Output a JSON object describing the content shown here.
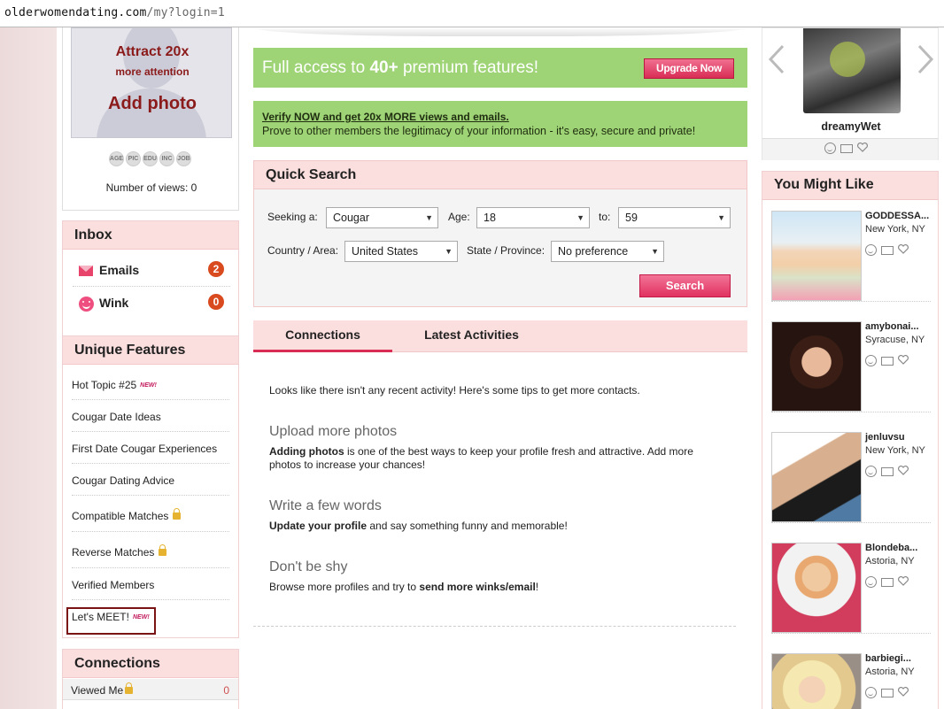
{
  "browser": {
    "url_main": "olderwomendating.com",
    "url_path": "/my?login=1"
  },
  "profile_box": {
    "attract": "Attract 20x",
    "more_attention": "more attention",
    "add_photo": "Add photo",
    "badges": [
      "AGE",
      "PIC",
      "EDU",
      "INC",
      "JOB"
    ],
    "views_label": "Number of views: 0"
  },
  "inbox": {
    "title": "Inbox",
    "items": [
      {
        "label": "Emails",
        "count": "2"
      },
      {
        "label": "Wink",
        "count": "0"
      }
    ]
  },
  "unique_features": {
    "title": "Unique Features",
    "items": [
      {
        "label": "Hot Topic #25",
        "badge": "NEW!"
      },
      {
        "label": "Cougar Date Ideas"
      },
      {
        "label": "First Date Cougar Experiences"
      },
      {
        "label": "Cougar Dating Advice"
      },
      {
        "label": "Compatible Matches"
      },
      {
        "label": "Reverse Matches"
      },
      {
        "label": "Verified Members"
      },
      {
        "label": "Let's MEET!",
        "badge": "NEW!"
      }
    ]
  },
  "connections_panel": {
    "title": "Connections",
    "viewed_label": "Viewed Me",
    "viewed_count": "0"
  },
  "upgrade_banner": {
    "text_pre": "Full access to ",
    "text_bold": "40+",
    "text_post": " premium features!",
    "button": "Upgrade Now"
  },
  "verify_banner": {
    "link": "Verify NOW and get 20x MORE views and emails.",
    "text": "Prove to other members the legitimacy of your information - it's easy, secure and private!"
  },
  "quick_search": {
    "title": "Quick Search",
    "seeking_label": "Seeking a:",
    "seeking_value": "Cougar",
    "age_label": "Age:",
    "age_from": "18",
    "to_label": "to:",
    "age_to": "59",
    "country_label": "Country / Area:",
    "country_value": "United States",
    "state_label": "State / Province:",
    "state_value": "No preference",
    "button": "Search"
  },
  "tabs": {
    "connections": "Connections",
    "latest": "Latest Activities"
  },
  "activity": {
    "intro": "Looks like there isn't any recent activity! Here's some tips to get more contacts.",
    "tips": [
      {
        "heading": "Upload more photos",
        "bold": "Adding photos",
        "text": " is one of the best ways to keep your profile fresh and attractive. Add more photos to increase your chances!"
      },
      {
        "heading": "Write a few words",
        "bold": "Update your profile",
        "text": " and say something funny and memorable!"
      },
      {
        "heading": "Don't be shy",
        "pre": "Browse more profiles and try to ",
        "bold": "send more winks/email",
        "text": "!"
      }
    ]
  },
  "featured_member": {
    "name": "dreamyWet"
  },
  "you_might_like": {
    "title": "You Might Like",
    "members": [
      {
        "name": "GODDESSA...",
        "location": "New York, NY"
      },
      {
        "name": "amybonai...",
        "location": "Syracuse, NY"
      },
      {
        "name": "jenluvsu",
        "location": "New York, NY"
      },
      {
        "name": "Blondeba...",
        "location": "Astoria, NY"
      },
      {
        "name": "barbiegi...",
        "location": "Astoria, NY"
      }
    ]
  }
}
